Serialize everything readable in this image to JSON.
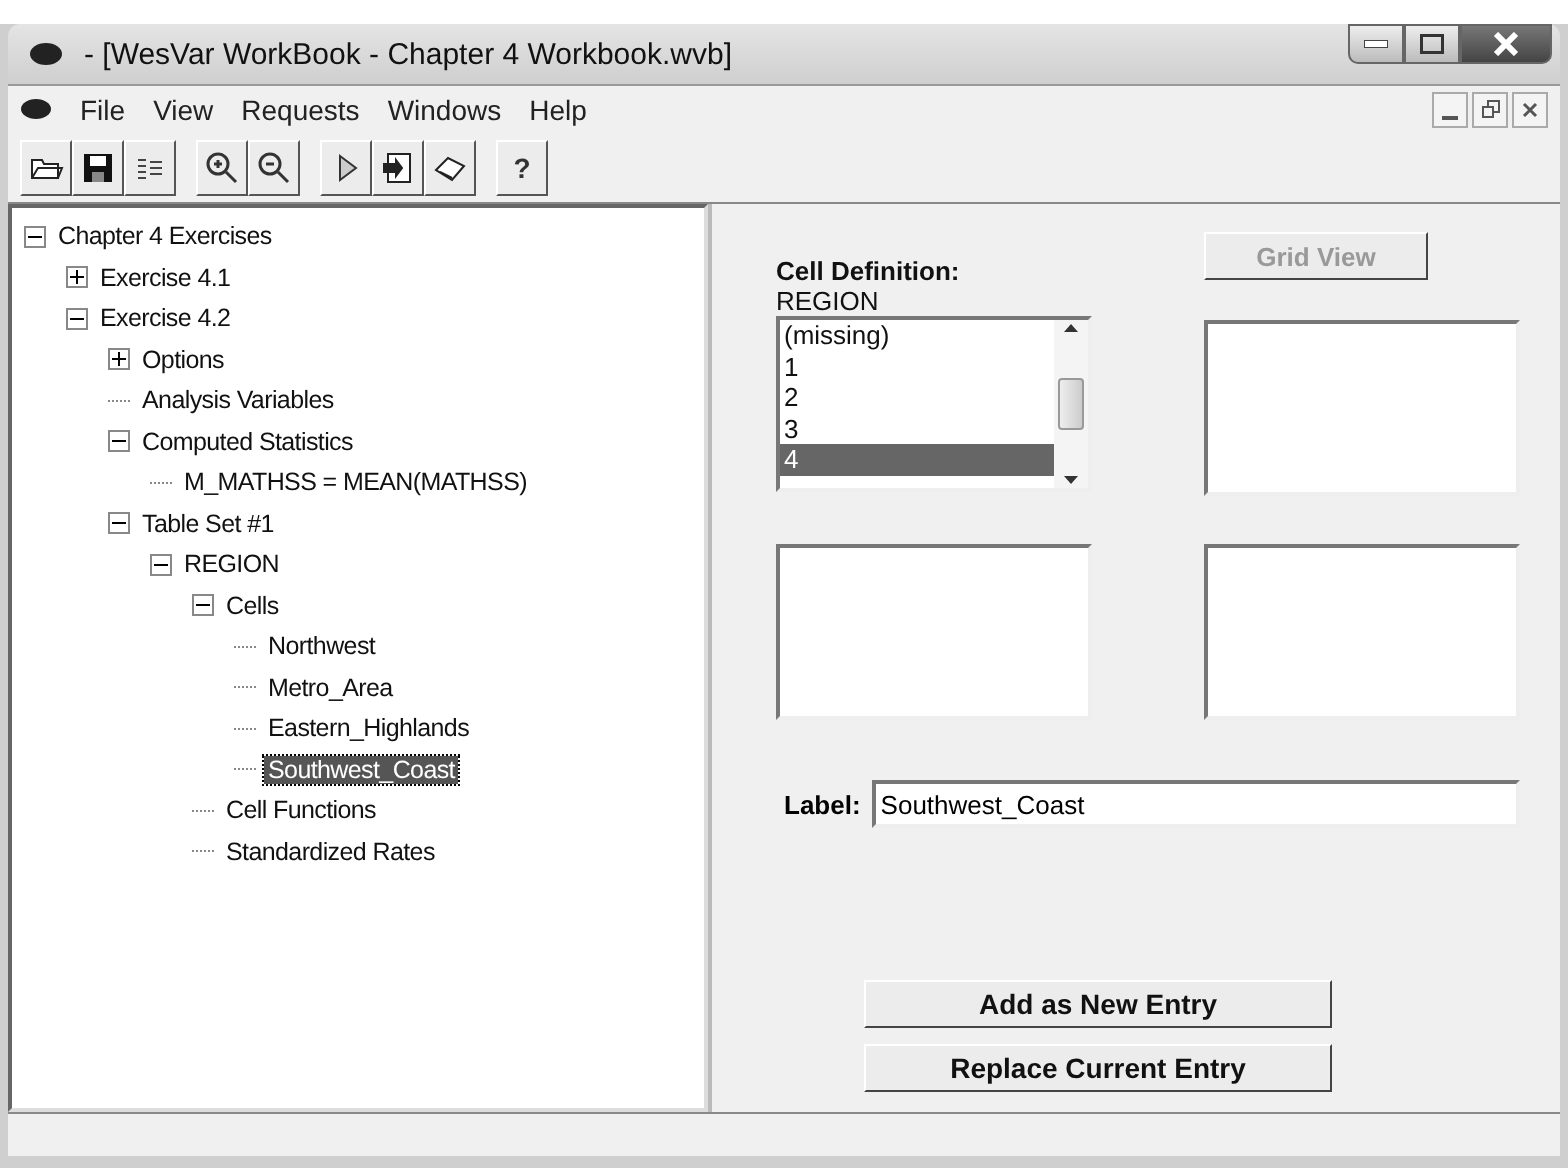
{
  "window": {
    "title": "- [WesVar WorkBook - Chapter 4 Workbook.wvb]"
  },
  "menu": [
    {
      "label": "File"
    },
    {
      "label": "View"
    },
    {
      "label": "Requests"
    },
    {
      "label": "Windows"
    },
    {
      "label": "Help"
    }
  ],
  "toolbar": {
    "help_label": "?"
  },
  "tree": [
    {
      "label": "Chapter 4 Exercises",
      "expanded": true,
      "selected": false,
      "children": [
        {
          "label": "Exercise 4.1",
          "expanded": false,
          "selected": false
        },
        {
          "label": "Exercise 4.2",
          "expanded": true,
          "selected": false,
          "children": [
            {
              "label": "Options",
              "expanded": false,
              "selected": false
            },
            {
              "label": "Analysis Variables",
              "selected": false
            },
            {
              "label": "Computed Statistics",
              "expanded": true,
              "selected": false,
              "children": [
                {
                  "label": "M_MATHSS = MEAN(MATHSS)",
                  "selected": false
                }
              ]
            },
            {
              "label": "Table Set #1",
              "expanded": true,
              "selected": false,
              "children": [
                {
                  "label": "REGION",
                  "expanded": true,
                  "selected": false,
                  "children": [
                    {
                      "label": "Cells",
                      "expanded": true,
                      "selected": false,
                      "children": [
                        {
                          "label": "Northwest",
                          "selected": false
                        },
                        {
                          "label": "Metro_Area",
                          "selected": false
                        },
                        {
                          "label": "Eastern_Highlands",
                          "selected": false
                        },
                        {
                          "label": "Southwest_Coast",
                          "selected": true
                        }
                      ]
                    },
                    {
                      "label": "Cell Functions",
                      "selected": false
                    },
                    {
                      "label": "Standardized Rates",
                      "selected": false
                    }
                  ]
                }
              ]
            }
          ]
        }
      ]
    }
  ],
  "cell_definition": {
    "heading": "Cell Definition:",
    "variable": "REGION",
    "values": [
      {
        "label": "(missing)",
        "selected": false
      },
      {
        "label": "1",
        "selected": false
      },
      {
        "label": "2",
        "selected": false
      },
      {
        "label": "3",
        "selected": false
      },
      {
        "label": "4",
        "selected": true
      }
    ]
  },
  "grid_view_button": {
    "label": "Grid View",
    "disabled": true
  },
  "label_field": {
    "label": "Label:",
    "value": "Southwest_Coast"
  },
  "buttons": [
    {
      "label": "Add as New Entry"
    },
    {
      "label": "Replace Current Entry"
    }
  ]
}
